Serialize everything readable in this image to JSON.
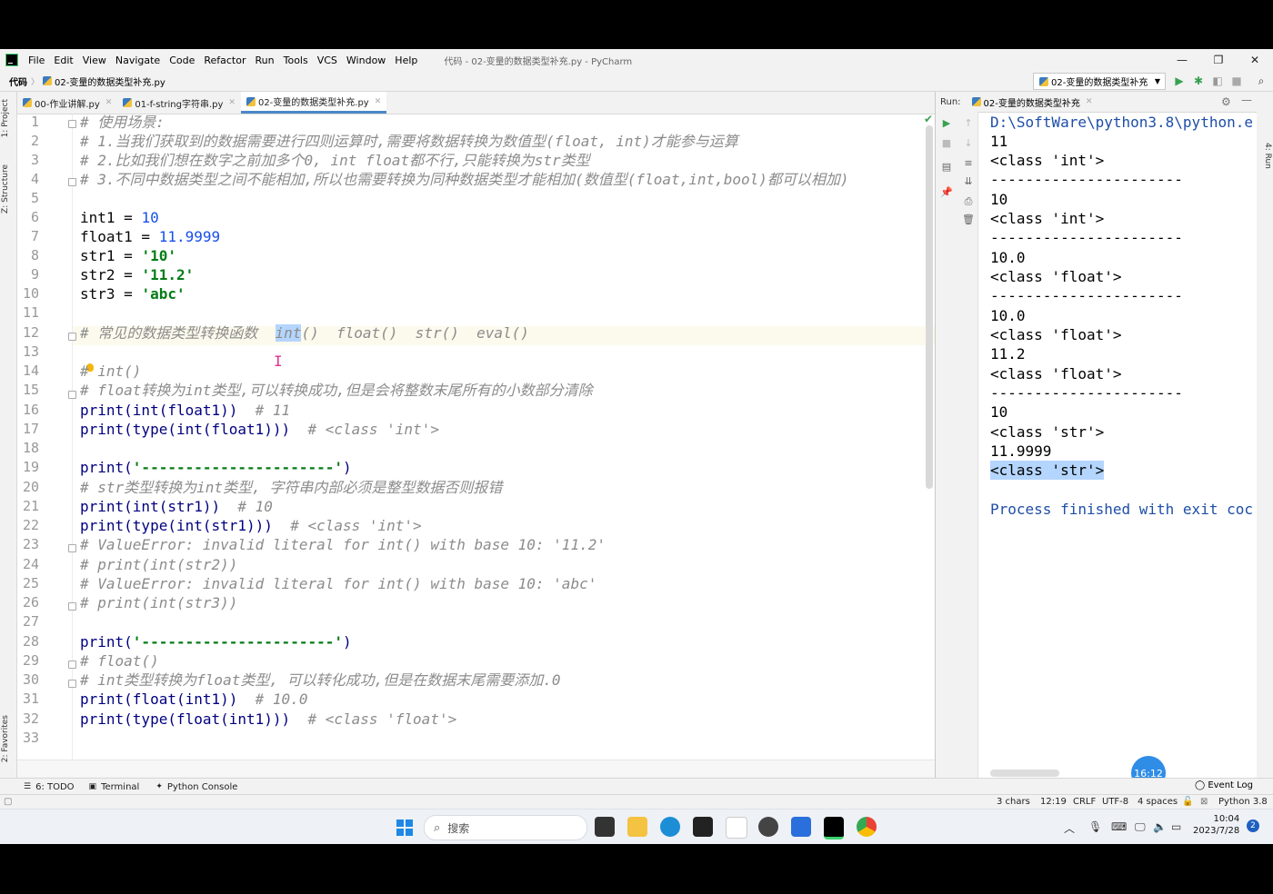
{
  "menu": {
    "items": [
      "File",
      "Edit",
      "View",
      "Navigate",
      "Code",
      "Refactor",
      "Run",
      "Tools",
      "VCS",
      "Window",
      "Help"
    ],
    "window_title": "代码 - 02-变量的数据类型补充.py - PyCharm"
  },
  "nav": {
    "root": "代码",
    "file": "02-变量的数据类型补充.py",
    "run_config": "02-变量的数据类型补充"
  },
  "side_tabs": {
    "project": "1: Project",
    "structure": "Z: Structure",
    "favorites": "2: Favorites",
    "run": "4: Run"
  },
  "tabs": [
    {
      "label": "00-作业讲解.py"
    },
    {
      "label": "01-f-string字符串.py"
    },
    {
      "label": "02-变量的数据类型补充.py"
    }
  ],
  "editor": {
    "lines": [
      "1",
      "2",
      "3",
      "4",
      "5",
      "6",
      "7",
      "8",
      "9",
      "10",
      "11",
      "12",
      "13",
      "14",
      "15",
      "16",
      "17",
      "18",
      "19",
      "20",
      "21",
      "22",
      "23",
      "24",
      "25",
      "26",
      "27",
      "28",
      "29",
      "30",
      "31",
      "32",
      "33"
    ],
    "code": {
      "l1": "# 使用场景:",
      "l2": "# 1.当我们获取到的数据需要进行四则运算时,需要将数据转换为数值型(float, int)才能参与运算",
      "l3": "# 2.比如我们想在数字之前加多个0, int float都不行,只能转换为str类型",
      "l4": "# 3.不同中数据类型之间不能相加,所以也需要转换为同种数据类型才能相加(数值型(float,int,bool)都可以相加)",
      "l6a": "int1 = ",
      "l6b": "10",
      "l7a": "float1 = ",
      "l7b": "11.9999",
      "l8a": "str1 = ",
      "l8b": "'10'",
      "l9a": "str2 = ",
      "l9b": "'11.2'",
      "l10a": "str3 = ",
      "l10b": "'abc'",
      "l12a": "# 常见的数据类型转换函数  ",
      "l12b": "int",
      "l12c": "()  float()  str()  eval()",
      "l14": "# int()",
      "l15": "# float转换为int类型,可以转换成功,但是会将整数末尾所有的小数部分清除",
      "l16a": "print(int(float1))",
      "l16b": "  # 11",
      "l17a": "print(type(int(float1)))",
      "l17b": "  # <class 'int'>",
      "l19a": "print(",
      "l19b": "'----------------------'",
      "l19c": ")",
      "l20": "# str类型转换为int类型, 字符串内部必须是整型数据否则报错",
      "l21a": "print(int(str1))",
      "l21b": "  # 10",
      "l22a": "print(type(int(str1)))",
      "l22b": "  # <class 'int'>",
      "l23": "# ValueError: invalid literal for int() with base 10: '11.2'",
      "l24": "# print(int(str2))",
      "l25": "# ValueError: invalid literal for int() with base 10: 'abc'",
      "l26": "# print(int(str3))",
      "l28a": "print(",
      "l28b": "'----------------------'",
      "l28c": ")",
      "l29": "# float()",
      "l30": "# int类型转换为float类型, 可以转化成功,但是在数据末尾需要添加.0",
      "l31a": "print(float(int1))",
      "l31b": "  # 10.0",
      "l32a": "print(type(float(int1)))",
      "l32b": "  # <class 'float'>"
    }
  },
  "run": {
    "label": "Run:",
    "tab": "02-变量的数据类型补充",
    "output": [
      "D:\\SoftWare\\python3.8\\python.e",
      "11",
      "<class 'int'>",
      "----------------------",
      "10",
      "<class 'int'>",
      "----------------------",
      "10.0",
      "<class 'float'>",
      "----------------------",
      "10.0",
      "<class 'float'>",
      "11.2",
      "<class 'float'>",
      "----------------------",
      "10",
      "<class 'str'>",
      "11.9999",
      "<class 'str'>",
      "",
      "Process finished with exit coc"
    ],
    "timer": "16:12"
  },
  "bottom_tools": {
    "todo": "6: TODO",
    "terminal": "Terminal",
    "python_console": "Python Console",
    "event_log": "Event Log"
  },
  "status": {
    "chars": "3 chars",
    "position": "12:19",
    "line_sep": "CRLF",
    "encoding": "UTF-8",
    "indent": "4 spaces",
    "interpreter": "Python 3.8"
  },
  "taskbar": {
    "search_placeholder": "搜索",
    "time": "10:04",
    "date": "2023/7/28",
    "notifications": "2"
  },
  "colors": {
    "accent": "#4a88c7",
    "comment": "#8c8c8c",
    "number": "#1750eb",
    "string": "#067d17",
    "selection": "#b4d5fe"
  }
}
